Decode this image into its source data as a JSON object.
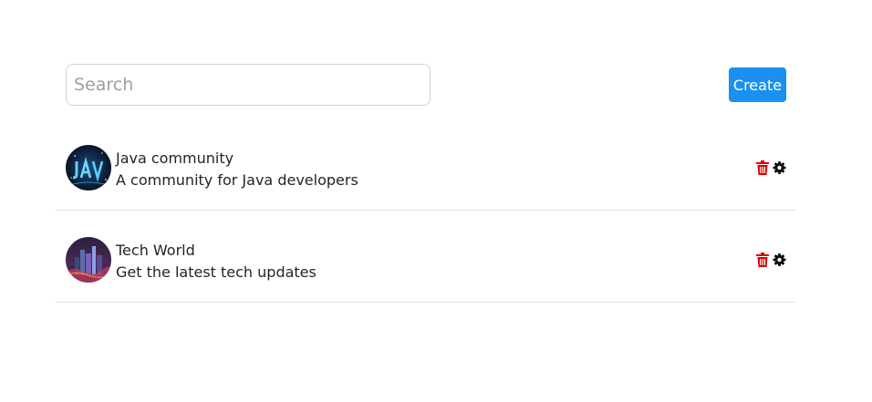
{
  "search": {
    "placeholder": "Search",
    "value": ""
  },
  "toolbar": {
    "create_label": "Create"
  },
  "communities": [
    {
      "name": "Java community",
      "description": "A community for Java developers",
      "avatar_icon": "java-logo-image"
    },
    {
      "name": "Tech World",
      "description": "Get the latest tech updates",
      "avatar_icon": "city-skyline-image"
    }
  ],
  "actions": {
    "delete_icon": "trash-icon",
    "settings_icon": "gear-icon"
  },
  "colors": {
    "primary": "#1a90f0",
    "danger": "#e00000",
    "divider": "#dee2e6",
    "text": "#212529"
  }
}
